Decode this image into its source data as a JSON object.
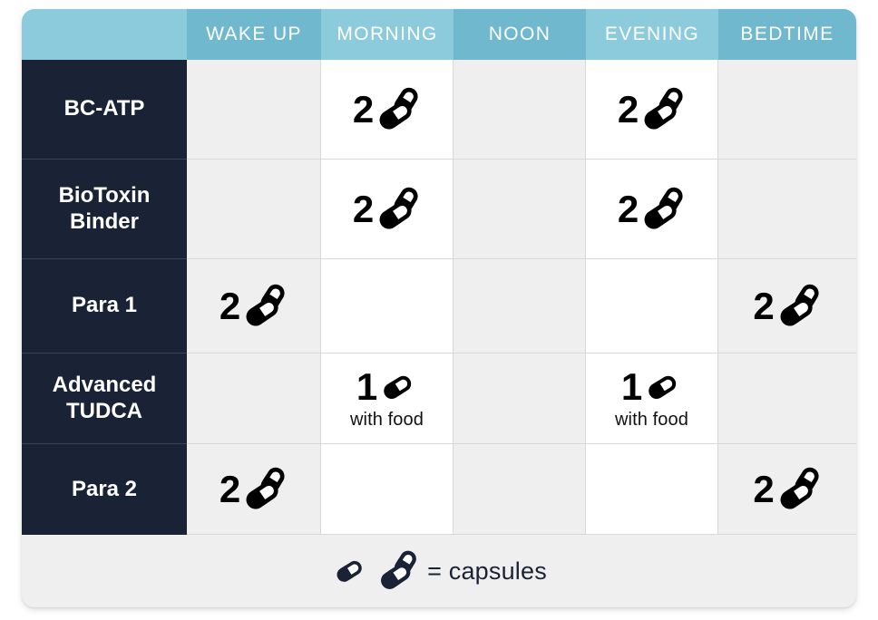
{
  "card": {
    "header": {
      "corner_label": "",
      "columns": [
        {
          "label": "WAKE UP",
          "tone": "a"
        },
        {
          "label": "MORNING",
          "tone": "b"
        },
        {
          "label": "NOON",
          "tone": "a"
        },
        {
          "label": "EVENING",
          "tone": "b"
        },
        {
          "label": "BEDTIME",
          "tone": "a"
        }
      ]
    },
    "rows": [
      {
        "label": "BC-ATP",
        "cells": [
          {
            "amount": "",
            "icon": "",
            "note": ""
          },
          {
            "amount": "2",
            "icon": "capsule-double",
            "note": ""
          },
          {
            "amount": "",
            "icon": "",
            "note": ""
          },
          {
            "amount": "2",
            "icon": "capsule-double",
            "note": ""
          },
          {
            "amount": "",
            "icon": "",
            "note": ""
          }
        ]
      },
      {
        "label": "BioToxin Binder",
        "cells": [
          {
            "amount": "",
            "icon": "",
            "note": ""
          },
          {
            "amount": "2",
            "icon": "capsule-double",
            "note": ""
          },
          {
            "amount": "",
            "icon": "",
            "note": ""
          },
          {
            "amount": "2",
            "icon": "capsule-double",
            "note": ""
          },
          {
            "amount": "",
            "icon": "",
            "note": ""
          }
        ]
      },
      {
        "label": "Para 1",
        "cells": [
          {
            "amount": "2",
            "icon": "capsule-double",
            "note": ""
          },
          {
            "amount": "",
            "icon": "",
            "note": ""
          },
          {
            "amount": "",
            "icon": "",
            "note": ""
          },
          {
            "amount": "",
            "icon": "",
            "note": ""
          },
          {
            "amount": "2",
            "icon": "capsule-double",
            "note": ""
          }
        ]
      },
      {
        "label": "Advanced TUDCA",
        "cells": [
          {
            "amount": "",
            "icon": "",
            "note": ""
          },
          {
            "amount": "1",
            "icon": "capsule-single",
            "note": "with food"
          },
          {
            "amount": "",
            "icon": "",
            "note": ""
          },
          {
            "amount": "1",
            "icon": "capsule-single",
            "note": "with food"
          },
          {
            "amount": "",
            "icon": "",
            "note": ""
          }
        ]
      },
      {
        "label": "Para 2",
        "cells": [
          {
            "amount": "2",
            "icon": "capsule-double",
            "note": ""
          },
          {
            "amount": "",
            "icon": "",
            "note": ""
          },
          {
            "amount": "",
            "icon": "",
            "note": ""
          },
          {
            "amount": "",
            "icon": "",
            "note": ""
          },
          {
            "amount": "2",
            "icon": "capsule-double",
            "note": ""
          }
        ]
      }
    ],
    "footer": {
      "icon_single": "capsule-single",
      "icon_double": "capsule-double",
      "legend_text": "= capsules"
    }
  },
  "colors": {
    "header_light": "#8ccbdc",
    "header_dark": "#6fb8cd",
    "row_label_bg": "#1a2236",
    "cell_gray": "#efefef",
    "cell_white": "#ffffff",
    "grid_line": "#d8d8d8",
    "capsule_black": "#000000",
    "capsule_navy": "#1a2236"
  }
}
